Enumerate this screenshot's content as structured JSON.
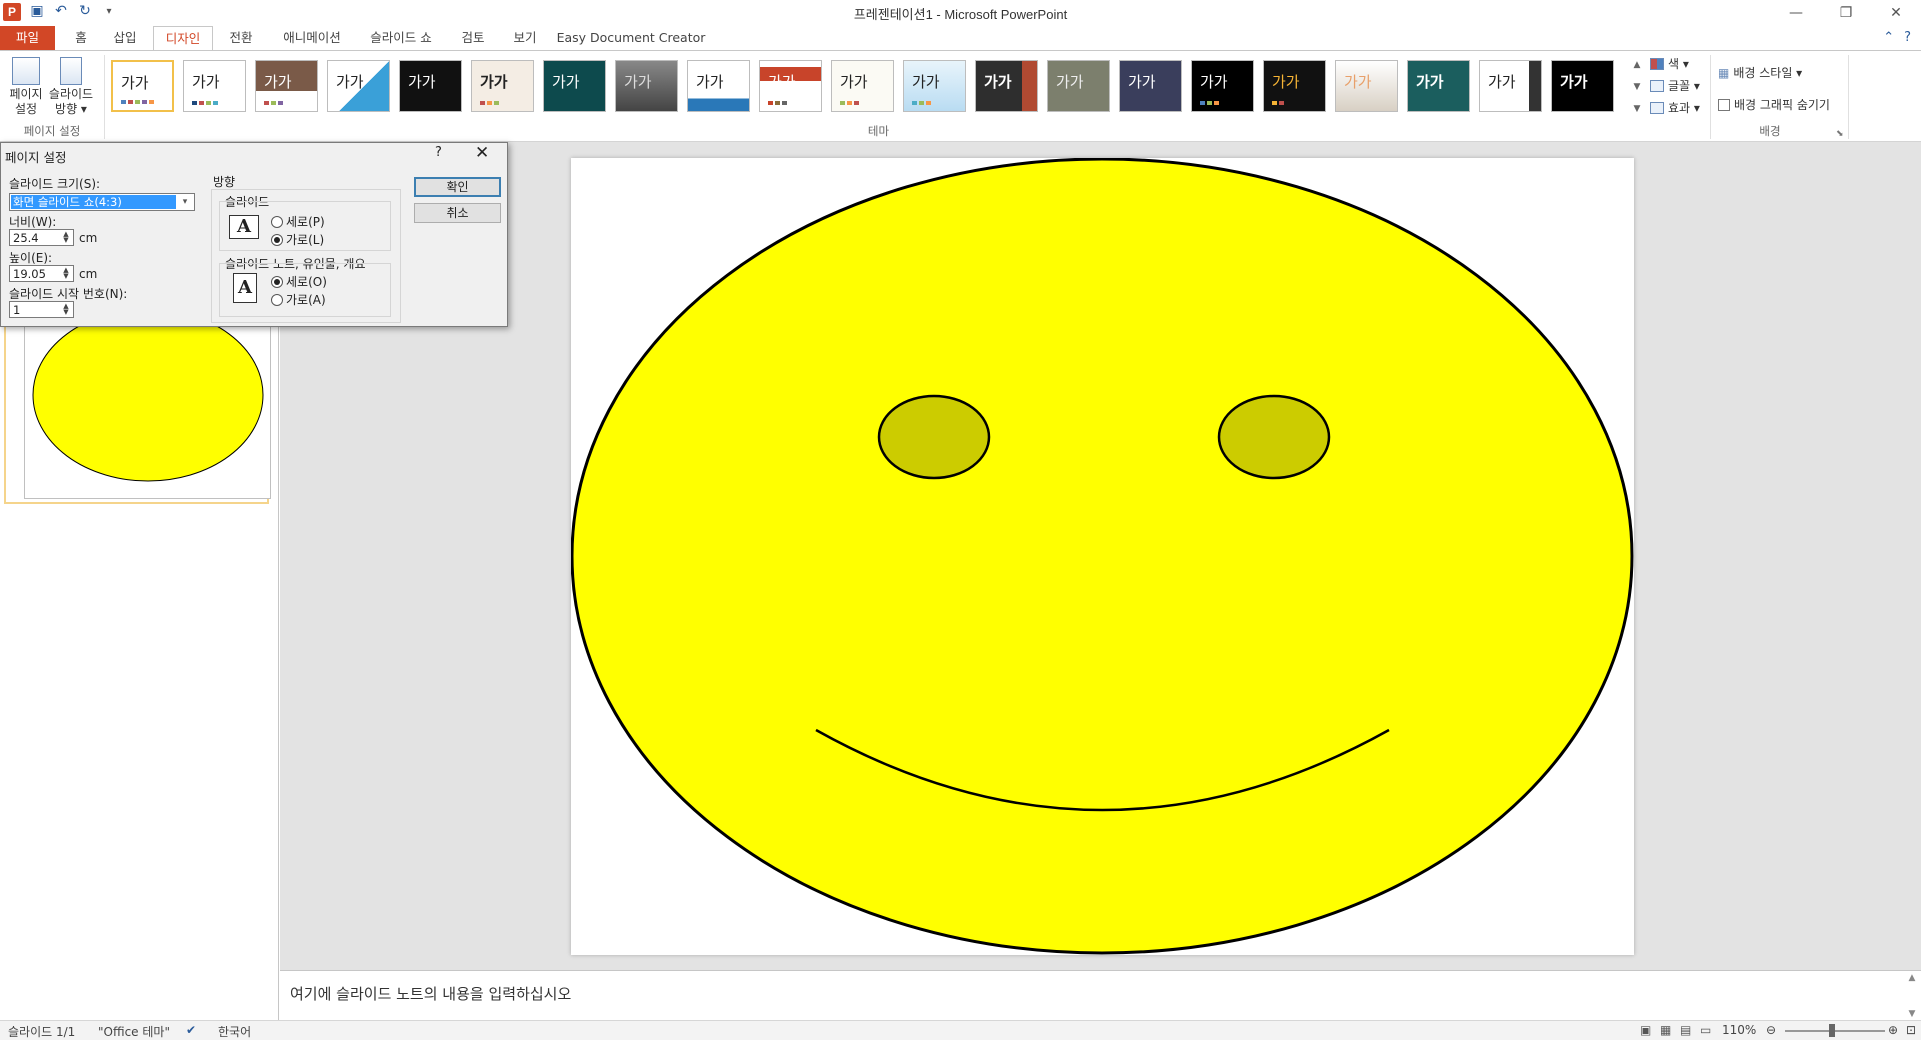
{
  "app": {
    "window_title": "프레젠테이션1 - Microsoft PowerPoint",
    "logo_letter": "P"
  },
  "tabs": [
    "파일",
    "홈",
    "삽입",
    "디자인",
    "전환",
    "애니메이션",
    "슬라이드 쇼",
    "검토",
    "보기",
    "Easy Document Creator"
  ],
  "active_tab": "디자인",
  "ribbon": {
    "page_setup_group": {
      "label": "페이지 설정",
      "page_setup_btn": [
        "페이지",
        "설정"
      ],
      "orientation_btn": [
        "슬라이드",
        "방향 ▾"
      ]
    },
    "themes_group": {
      "label": "테마",
      "theme_sample_text": "가가",
      "theme_count": 21
    },
    "theme_options": {
      "colors": "색 ▾",
      "fonts": "글꼴 ▾",
      "effects": "효과 ▾"
    },
    "background_group": {
      "label": "배경",
      "background_styles": "배경 스타일 ▾",
      "hide_graphics": "배경 그래픽 숨기기"
    }
  },
  "dialog": {
    "title": "페이지 설정",
    "help": "?",
    "close": "✕",
    "slide_size_label": "슬라이드 크기(S):",
    "slide_size_value": "화면 슬라이드 쇼(4:3)",
    "width_label": "너비(W):",
    "width_value": "25.4",
    "width_unit": "cm",
    "height_label": "높이(E):",
    "height_value": "19.05",
    "height_unit": "cm",
    "start_number_label": "슬라이드 시작 번호(N):",
    "start_number_value": "1",
    "orientation_title": "방향",
    "slides_group": "슬라이드",
    "slides_portrait": "세로(P)",
    "slides_landscape": "가로(L)",
    "notes_group": "슬라이드 노트, 유인물, 개요",
    "notes_portrait": "세로(O)",
    "notes_landscape": "가로(A)",
    "ok": "확인",
    "cancel": "취소"
  },
  "notes_placeholder": "여기에 슬라이드 노트의 내용을 입력하십시오",
  "status": {
    "slide_counter": "슬라이드 1/1",
    "theme": "\"Office 테마\"",
    "language": "한국어",
    "zoom": "110%"
  },
  "colors": {
    "accent": "#d24726",
    "face": "#ffff00",
    "eyes": "#cccc00"
  }
}
